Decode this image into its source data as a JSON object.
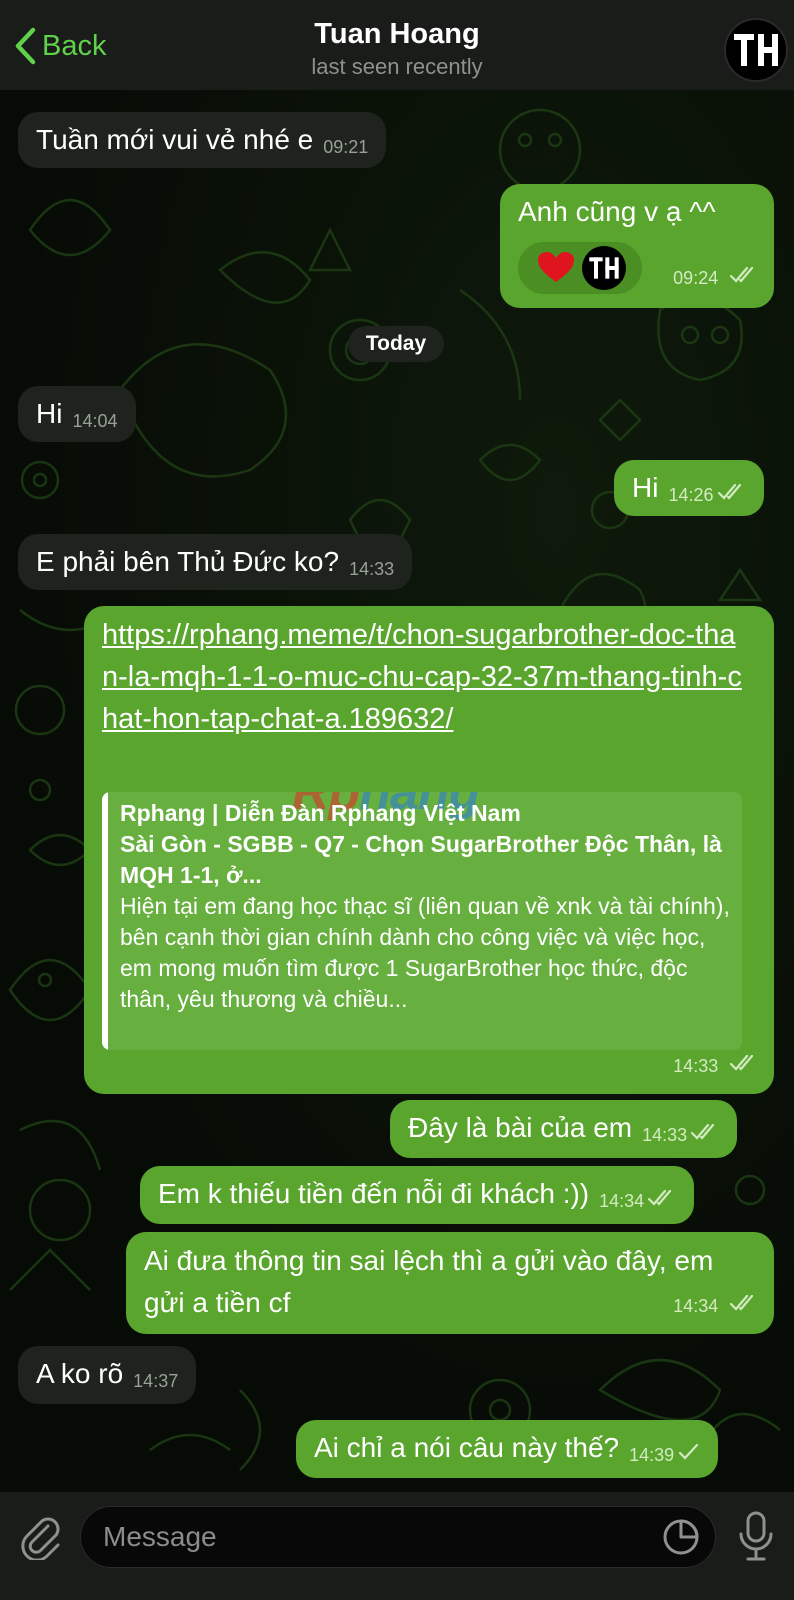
{
  "header": {
    "back_label": "Back",
    "contact_name": "Tuan Hoang",
    "status": "last seen recently"
  },
  "date_separator": "Today",
  "messages": [
    {
      "direction": "in",
      "text": "Tuần mới vui vẻ nhé e",
      "time": "09:21"
    },
    {
      "direction": "out",
      "text": "Anh cũng v ạ ^^",
      "time": "09:24",
      "read": true
    },
    {
      "direction": "in",
      "text": "Hi",
      "time": "14:04"
    },
    {
      "direction": "out",
      "text": "Hi",
      "time": "14:26",
      "read": true
    },
    {
      "direction": "in",
      "text": "E phải bên Thủ Đức ko?",
      "time": "14:33"
    },
    {
      "direction": "out",
      "text": "https://rphang.meme/t/chon-sugarbrother-doc-than-la-mqh-1-1-o-muc-chu-cap-32-37m-thang-tinh-chat-hon-tap-chat-a.189632/",
      "time": "14:33",
      "read": true
    },
    {
      "direction": "out",
      "text": "Đây là bài của em",
      "time": "14:33",
      "read": true
    },
    {
      "direction": "out",
      "text": "Em k thiếu tiền đến nỗi đi khách :))",
      "time": "14:34",
      "read": true
    },
    {
      "direction": "out",
      "text": "Ai đưa thông tin sai lệch thì a gửi vào đây, em gửi a tiền cf",
      "time": "14:34",
      "read": true
    },
    {
      "direction": "in",
      "text": "A ko rõ",
      "time": "14:37"
    },
    {
      "direction": "out",
      "text": "Ai chỉ a nói câu này thế?",
      "time": "14:39",
      "read": false
    }
  ],
  "link_preview": {
    "site": "Rphang | Diễn Đàn Rphang Việt Nam",
    "title": "Sài Gòn - SGBB - Q7 - Chọn SugarBrother Độc Thân, là MQH 1-1, ở...",
    "description": "Hiện tại em đang học thạc sĩ (liên quan về xnk và tài chính), bên cạnh thời gian chính dành cho công việc và việc học, em mong muốn tìm được 1 SugarBrother học thức, độc thân, yêu thương và chiều...",
    "watermark_left": "Rp",
    "watermark_right": "hang"
  },
  "reaction": {
    "emoji": "heart-icon"
  },
  "composer": {
    "placeholder": "Message"
  },
  "colors": {
    "accent": "#5fd14b",
    "outgoing_bubble": "#5aa52d",
    "incoming_bubble": "#1e231d",
    "header": "#1a1c1a"
  }
}
